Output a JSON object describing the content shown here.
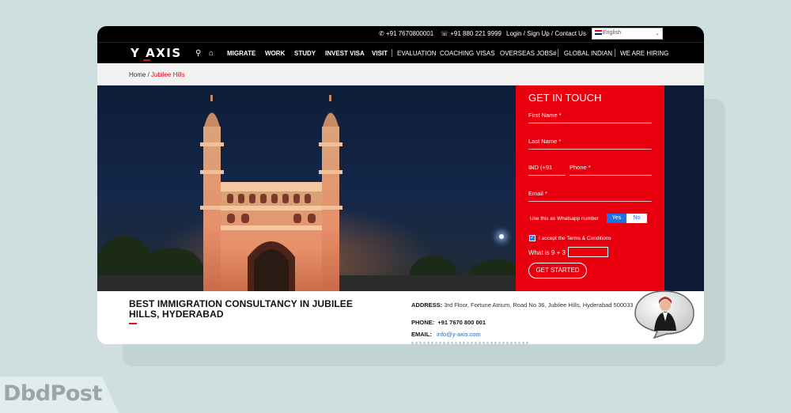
{
  "topbar": {
    "phone1": "+91 7670800001",
    "phone2": "+91 880 221 9999",
    "links": "Login / Sign Up / Contact Us",
    "language": "English"
  },
  "nav": {
    "logo": "Y AXIS",
    "items_bold": [
      "MIGRATE",
      "WORK",
      "STUDY",
      "INVEST VISA",
      "VISIT"
    ],
    "items_light": [
      "EVALUATION",
      "COACHING",
      "VISAS",
      "OVERSEAS JOBS#",
      "GLOBAL INDIAN",
      "WE ARE HIRING"
    ]
  },
  "breadcrumb": {
    "home": "Home",
    "separator": " / ",
    "current": "Jubilee Hills"
  },
  "form": {
    "title": "GET IN TOUCH",
    "first_name": "First Name *",
    "last_name": "Last Name *",
    "country_code": "IND (+91",
    "phone": "Phone *",
    "email": "Email *",
    "whatsapp_label": "Use this as Whatsapp number",
    "toggle_yes": "Yes",
    "toggle_no": "No",
    "accept": "I accept the Terms & Conditions",
    "captcha_question": "What is 9 + 3",
    "submit": "GET STARTED"
  },
  "info": {
    "heading": "BEST IMMIGRATION CONSULTANCY IN JUBILEE HILLS, HYDERABAD",
    "address_label": "ADDRESS:",
    "address": "3rd Floor, Fortune Atrium, Road No 36, Jubilee Hills, Hyderabad 500033",
    "phone_label": "PHONE:",
    "phone": "+91 7670 800 001",
    "email_label": "EMAIL:",
    "email": "info@y-axis.com"
  },
  "watermark": "DbdPost",
  "colors": {
    "brand_red": "#e8000f",
    "nav_black": "#000000",
    "link_blue": "#1a6fc4"
  }
}
